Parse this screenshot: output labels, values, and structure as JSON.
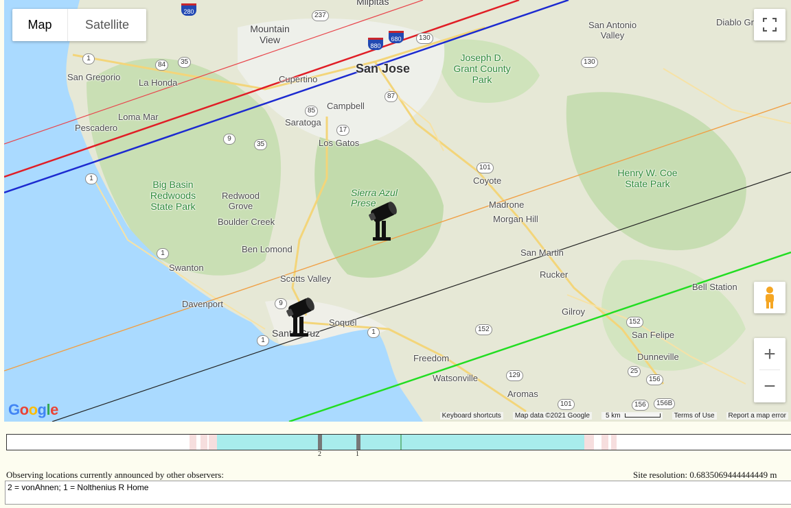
{
  "map": {
    "type_buttons": {
      "map": "Map",
      "satellite": "Satellite"
    },
    "logo": "Google",
    "footer": {
      "shortcuts": "Keyboard shortcuts",
      "map_data": "Map data ©2021 Google",
      "scale": "5 km",
      "terms": "Terms of Use",
      "report": "Report a map error"
    },
    "places": {
      "milpitas": "Milpitas",
      "mountain_view": "Mountain View",
      "san_jose": "San Jose",
      "san_antonio_valley": "San Antonio Valley",
      "diablo": "Diablo Gr",
      "joseph_grant": "Joseph D. Grant County Park",
      "san_gregorio": "San Gregorio",
      "la_honda": "La Honda",
      "cupertino": "Cupertino",
      "campbell": "Campbell",
      "loma_mar": "Loma Mar",
      "pescadero": "Pescadero",
      "saratoga": "Saratoga",
      "los_gatos": "Los Gatos",
      "coyote": "Coyote",
      "henry_coe": "Henry W. Coe State Park",
      "big_basin": "Big Basin Redwoods State Park",
      "redwood_grove": "Redwood Grove",
      "sierra_azul": "Sierra Azul Prese",
      "madrone": "Madrone",
      "morgan_hill": "Morgan Hill",
      "boulder_creek": "Boulder Creek",
      "ben_lomond": "Ben Lomond",
      "san_martin": "San Martin",
      "swanton": "Swanton",
      "scotts_valley": "Scotts Valley",
      "rucker": "Rucker",
      "bell_station": "Bell Station",
      "davenport": "Davenport",
      "soquel": "Soquel",
      "santa_cruz": "Santa Cruz",
      "gilroy": "Gilroy",
      "san_felipe": "San Felipe",
      "dunneville": "Dunneville",
      "freedom": "Freedom",
      "watsonville": "Watsonville",
      "aromas": "Aromas"
    },
    "routes": [
      "280",
      "237",
      "680",
      "880",
      "130",
      "84",
      "35",
      "85",
      "87",
      "17",
      "9",
      "35",
      "101",
      "1",
      "1",
      "1",
      "1",
      "9",
      "1",
      "152",
      "152",
      "129",
      "101",
      "25",
      "156",
      "156",
      "156B",
      "130"
    ],
    "path_colors": {
      "red_thin": "#e8464c",
      "red": "#e01e26",
      "blue": "#1c2ad0",
      "orange": "#f0a046",
      "black": "#222222",
      "green": "#22dd22"
    },
    "markers": [
      {
        "id": "1",
        "observer": "Nolthenius R Home",
        "icon": "telescope-icon"
      },
      {
        "id": "2",
        "observer": "vonAhnen",
        "icon": "telescope-icon"
      }
    ]
  },
  "timeline": {
    "tick_labels": [
      "2",
      "1"
    ],
    "colors": {
      "band": "#a8ecec",
      "edge": "#f6dede",
      "marker": "#777777",
      "center": "#2a8a2a"
    }
  },
  "observers": {
    "label": "Observing locations currently announced by other observers:",
    "site_resolution": "Site resolution: 0.6835069444444449 m",
    "list_text": "2 = vonAhnen; 1 = Nolthenius R Home"
  }
}
